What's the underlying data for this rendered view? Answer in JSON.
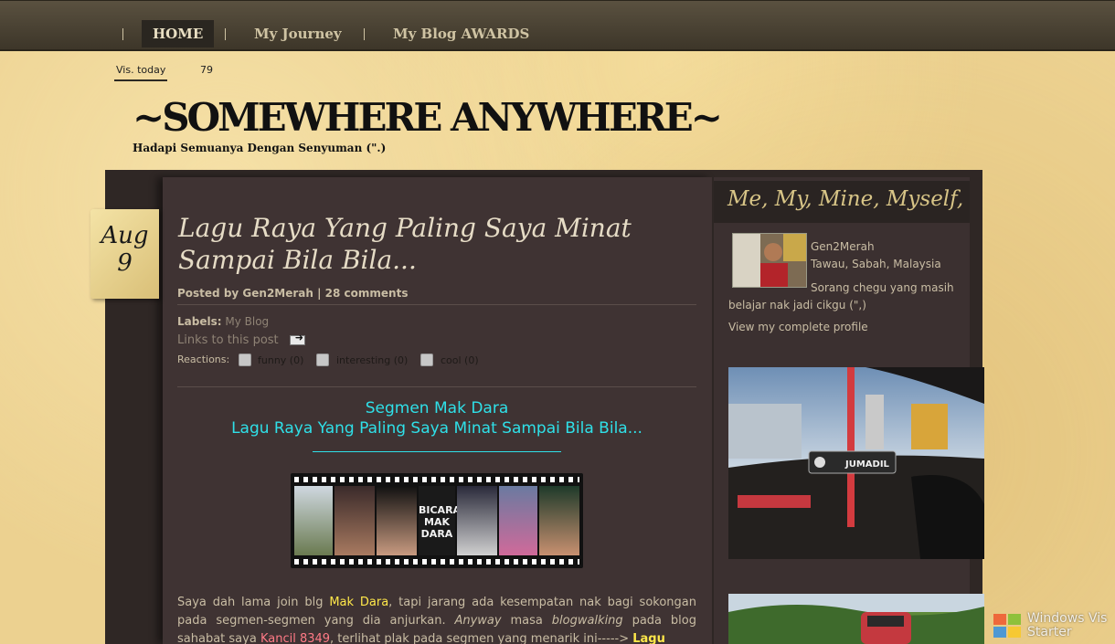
{
  "nav": {
    "items": [
      {
        "label": "HOME"
      },
      {
        "label": "My Journey"
      },
      {
        "label": "My Blog AWARDS"
      }
    ]
  },
  "visitor": {
    "label": "Vis. today",
    "count": "79"
  },
  "header": {
    "title": "~SOMEWHERE ANYWHERE~",
    "description": "Hadapi Semuanya Dengan Senyuman (\".)"
  },
  "post": {
    "date_month": "Aug",
    "date_day": "9",
    "title": "Lagu Raya Yang Paling Saya Minat Sampai Bila Bila...",
    "meta": "Posted by Gen2Merah | 28 comments",
    "labels_prefix": "Labels:",
    "label_link": "My Blog",
    "links_to_post": "Links to this post",
    "reactions_label": "Reactions:",
    "reactions": [
      {
        "label": "funny (0)"
      },
      {
        "label": "interesting (0)"
      },
      {
        "label": "cool (0)"
      }
    ],
    "segment_line1": "Segmen Mak Dara",
    "segment_line2": "Lagu Raya Yang Paling Saya Minat Sampai Bila Bila...",
    "body": {
      "t1": "Saya dah lama join blg ",
      "mak_dara": "Mak Dara",
      "t2": ", tapi jarang ada kesempatan nak bagi sokongan pada segmen-segmen yang dia anjurkan. ",
      "anyway": "Anyway",
      "t3": " masa ",
      "blogwalking": "blogwalking",
      "t4": " pada blog sahabat saya ",
      "kancil": "Kancil 8349",
      "t5": ", terlihat plak pada segmen yang menarik ini-----> ",
      "lagu": "Lagu"
    }
  },
  "sidebar": {
    "title": "Me, My, Mine, Myself,",
    "profile_name": "Gen2Merah",
    "profile_location": "Tawau, Sabah, Malaysia",
    "profile_description": "Sorang chegu yang masih belajar nak jadi cikgu (\",)",
    "profile_link": "View my complete profile"
  },
  "photo1": {
    "keychain_text": "JUMADIL"
  },
  "filmstrip": {
    "center_text_line1": "BICARA",
    "center_text_line2": "MAK",
    "center_text_line3": "DARA"
  },
  "watermark": {
    "line1": "Windows Vis",
    "line2": "Starter"
  }
}
